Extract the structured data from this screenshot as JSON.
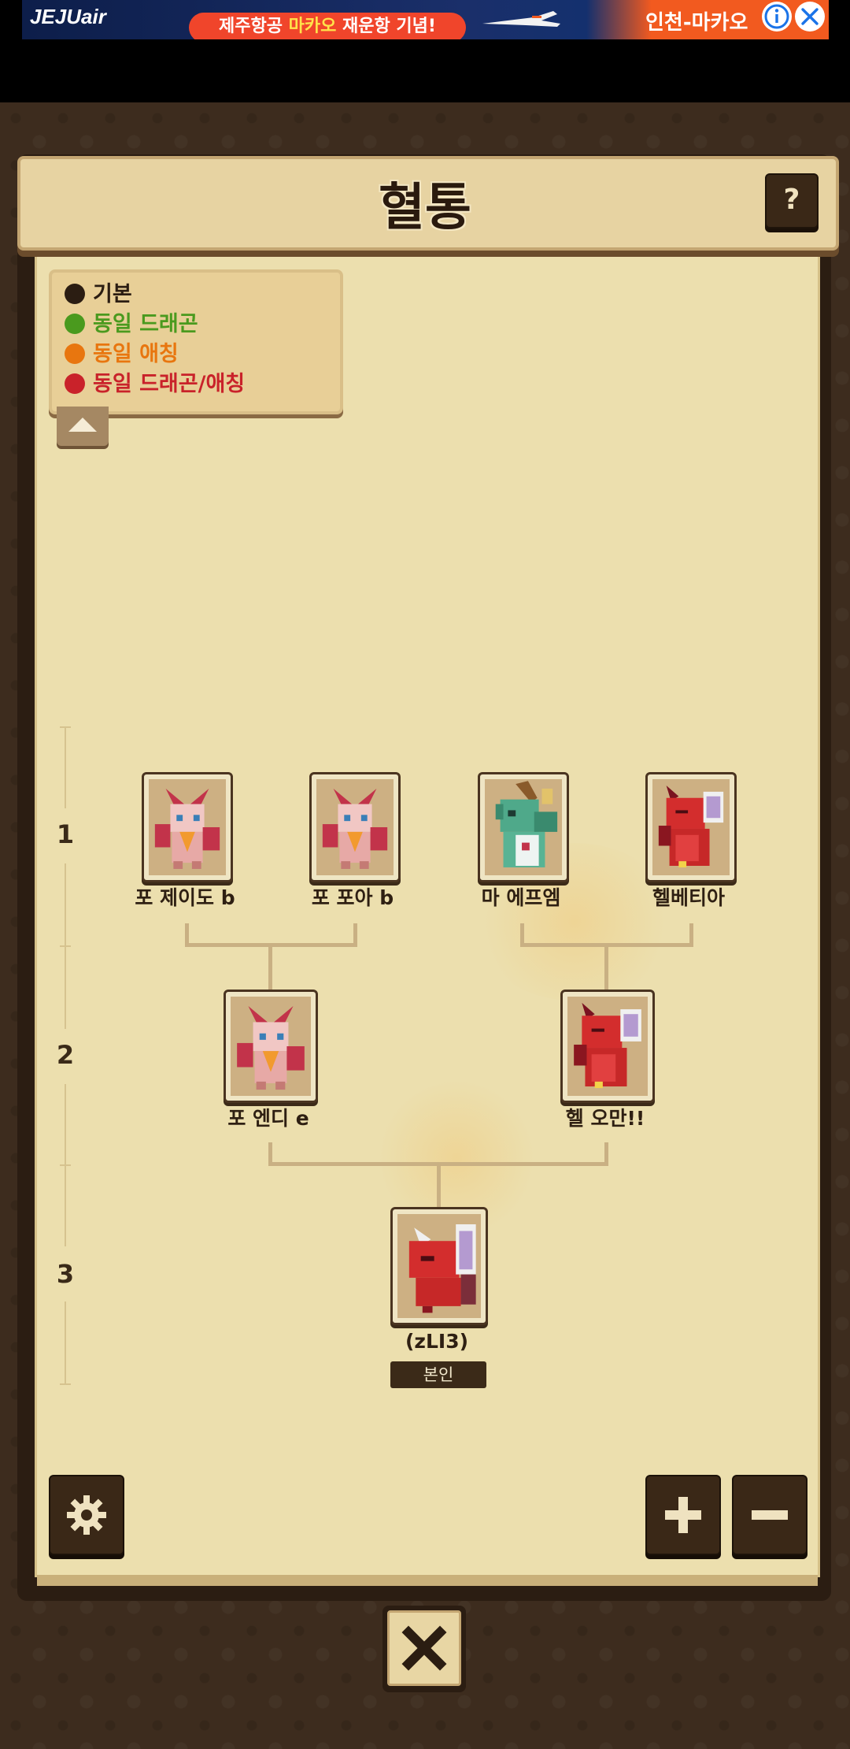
{
  "ad": {
    "brand": "JEJUair",
    "headline_prefix": "제주항공 ",
    "headline_highlight": "마카오",
    "headline_suffix": " 재운항 기념!",
    "route": "인천-마카오",
    "info_icon": "info-icon",
    "close_icon": "close-icon"
  },
  "header": {
    "title": "혈통",
    "help_label": "?"
  },
  "legend": {
    "items": [
      {
        "label": "기본",
        "color": "#2b1d12"
      },
      {
        "label": "동일 드래곤",
        "color": "#4a9a1e"
      },
      {
        "label": "동일 애칭",
        "color": "#e8760f"
      },
      {
        "label": "동일 드래곤/애칭",
        "color": "#c9222a"
      }
    ],
    "toggle_icon": "chevron-up-icon"
  },
  "generations": [
    "1",
    "2",
    "3"
  ],
  "tree": {
    "gen1": [
      {
        "name": "포 제이도 b",
        "species": "fox-dragon",
        "name_color": "#2e1f12"
      },
      {
        "name": "포 포아 b",
        "species": "fox-dragon",
        "name_color": "#2e1f12"
      },
      {
        "name": "마 에프엠",
        "species": "green-dragon",
        "name_color": "#2e1f12"
      },
      {
        "name": "헬베티아",
        "species": "red-dragon",
        "name_color": "#2e1f12"
      }
    ],
    "gen2": [
      {
        "name": "포 엔디 e",
        "species": "fox-dragon"
      },
      {
        "name": "헬 오만!!",
        "species": "red-dragon"
      }
    ],
    "gen3": [
      {
        "name": "(zLI3)",
        "species": "red-dragon-child",
        "badge": "본인"
      }
    ]
  },
  "controls": {
    "settings_icon": "gear-icon",
    "zoom_in_icon": "plus-icon",
    "zoom_out_icon": "minus-icon",
    "close_icon": "close-icon"
  }
}
